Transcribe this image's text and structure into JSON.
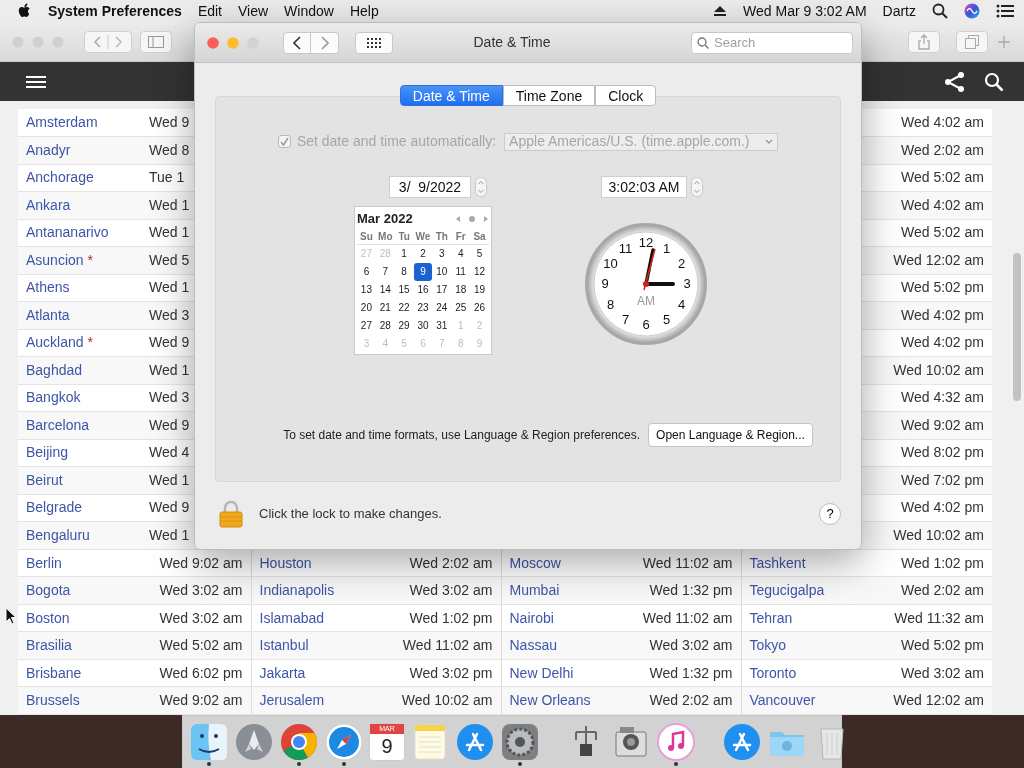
{
  "menu_bar": {
    "app_name": "System Preferences",
    "menus": [
      "Edit",
      "View",
      "Window",
      "Help"
    ],
    "clock": "Wed Mar 9  3:02 AM",
    "user": "Dartz"
  },
  "browser": {
    "table": {
      "rows": [
        {
          "city_a": "Amsterdam",
          "time_a": "Wed 9",
          "time_d": "Wed 4:02 am"
        },
        {
          "city_a": "Anadyr",
          "time_a": "Wed 8",
          "time_d": "Wed 2:02 am"
        },
        {
          "city_a": "Anchorage",
          "time_a": "Tue 1",
          "time_d": "Wed 5:02 am"
        },
        {
          "city_a": "Ankara",
          "time_a": "Wed 1",
          "time_d": "Wed 4:02 am"
        },
        {
          "city_a": "Antananarivo",
          "time_a": "Wed 1",
          "time_d": "Wed 5:02 am"
        },
        {
          "city_a": "Asuncion",
          "mark_a": "*",
          "time_a": "Wed 5",
          "time_d": "Wed 12:02 am"
        },
        {
          "city_a": "Athens",
          "time_a": "Wed 1",
          "time_d": "Wed 5:02 pm"
        },
        {
          "city_a": "Atlanta",
          "time_a": "Wed 3",
          "time_d": "Wed 4:02 pm"
        },
        {
          "city_a": "Auckland",
          "mark_a": "*",
          "time_a": "Wed 9",
          "time_d": "Wed 4:02 pm"
        },
        {
          "city_a": "Baghdad",
          "time_a": "Wed 1",
          "time_d": "Wed 10:02 am"
        },
        {
          "city_a": "Bangkok",
          "time_a": "Wed 3",
          "time_d": "Wed 4:32 am"
        },
        {
          "city_a": "Barcelona",
          "time_a": "Wed 9",
          "time_d": "Wed 9:02 am"
        },
        {
          "city_a": "Beijing",
          "time_a": "Wed 4",
          "time_d": "Wed 8:02 pm"
        },
        {
          "city_a": "Beirut",
          "time_a": "Wed 1",
          "time_d": "Wed 7:02 pm"
        },
        {
          "city_a": "Belgrade",
          "time_a": "Wed 9",
          "time_d": "Wed 4:02 pm"
        },
        {
          "city_a": "Bengaluru",
          "time_a": "Wed 1",
          "time_d": "Wed 10:02 am"
        },
        {
          "city_a": "Berlin",
          "time_a": "Wed 9:02 am",
          "city_b": "Houston",
          "time_b": "Wed 2:02 am",
          "city_c": "Moscow",
          "time_c": "Wed 11:02 am",
          "city_d": "Tashkent",
          "time_d": "Wed 1:02 pm"
        },
        {
          "city_a": "Bogota",
          "time_a": "Wed 3:02 am",
          "city_b": "Indianapolis",
          "time_b": "Wed 3:02 am",
          "city_c": "Mumbai",
          "time_c": "Wed 1:32 pm",
          "city_d": "Tegucigalpa",
          "time_d": "Wed 2:02 am"
        },
        {
          "city_a": "Boston",
          "time_a": "Wed 3:02 am",
          "city_b": "Islamabad",
          "time_b": "Wed 1:02 pm",
          "city_c": "Nairobi",
          "time_c": "Wed 11:02 am",
          "city_d": "Tehran",
          "time_d": "Wed 11:32 am"
        },
        {
          "city_a": "Brasilia",
          "time_a": "Wed 5:02 am",
          "city_b": "Istanbul",
          "time_b": "Wed 11:02 am",
          "city_c": "Nassau",
          "time_c": "Wed 3:02 am",
          "city_d": "Tokyo",
          "time_d": "Wed 5:02 pm"
        },
        {
          "city_a": "Brisbane",
          "time_a": "Wed 6:02 pm",
          "city_b": "Jakarta",
          "time_b": "Wed 3:02 pm",
          "city_c": "New Delhi",
          "time_c": "Wed 1:32 pm",
          "city_d": "Toronto",
          "time_d": "Wed 3:02 am"
        },
        {
          "city_a": "Brussels",
          "time_a": "Wed 9:02 am",
          "city_b": "Jerusalem",
          "time_b": "Wed 10:02 am",
          "city_c": "New Orleans",
          "time_c": "Wed 2:02 am",
          "city_d": "Vancouver",
          "time_d": "Wed 12:02 am"
        }
      ]
    }
  },
  "dialog": {
    "title": "Date & Time",
    "search": {
      "placeholder": "Search"
    },
    "tabs": [
      {
        "label": "Date & Time",
        "selected": true
      },
      {
        "label": "Time Zone",
        "selected": false
      },
      {
        "label": "Clock",
        "selected": false
      }
    ],
    "auto_set": {
      "label": "Set date and time automatically:",
      "checked": true,
      "disabled": true,
      "server": "Apple Americas/U.S. (time.apple.com.)"
    },
    "date_field": "3/  9/2022",
    "calendar": {
      "month": "Mar 2022",
      "weekdays": [
        "Su",
        "Mo",
        "Tu",
        "We",
        "Th",
        "Fr",
        "Sa"
      ],
      "weeks": [
        [
          {
            "day": "27",
            "other_month": true,
            "selected": false
          },
          {
            "day": "28",
            "other_month": true,
            "selected": false
          },
          {
            "day": "1",
            "other_month": false,
            "selected": false
          },
          {
            "day": "2",
            "other_month": false,
            "selected": false
          },
          {
            "day": "3",
            "other_month": false,
            "selected": false
          },
          {
            "day": "4",
            "other_month": false,
            "selected": false
          },
          {
            "day": "5",
            "other_month": false,
            "selected": false
          }
        ],
        [
          {
            "day": "6",
            "other_month": false,
            "selected": false
          },
          {
            "day": "7",
            "other_month": false,
            "selected": false
          },
          {
            "day": "8",
            "other_month": false,
            "selected": false
          },
          {
            "day": "9",
            "other_month": false,
            "selected": true
          },
          {
            "day": "10",
            "other_month": false,
            "selected": false
          },
          {
            "day": "11",
            "other_month": false,
            "selected": false
          },
          {
            "day": "12",
            "other_month": false,
            "selected": false
          }
        ],
        [
          {
            "day": "13",
            "other_month": false,
            "selected": false
          },
          {
            "day": "14",
            "other_month": false,
            "selected": false
          },
          {
            "day": "15",
            "other_month": false,
            "selected": false
          },
          {
            "day": "16",
            "other_month": false,
            "selected": false
          },
          {
            "day": "17",
            "other_month": false,
            "selected": false
          },
          {
            "day": "18",
            "other_month": false,
            "selected": false
          },
          {
            "day": "19",
            "other_month": false,
            "selected": false
          }
        ],
        [
          {
            "day": "20",
            "other_month": false,
            "selected": false
          },
          {
            "day": "21",
            "other_month": false,
            "selected": false
          },
          {
            "day": "22",
            "other_month": false,
            "selected": false
          },
          {
            "day": "23",
            "other_month": false,
            "selected": false
          },
          {
            "day": "24",
            "other_month": false,
            "selected": false
          },
          {
            "day": "25",
            "other_month": false,
            "selected": false
          },
          {
            "day": "26",
            "other_month": false,
            "selected": false
          }
        ],
        [
          {
            "day": "27",
            "other_month": false,
            "selected": false
          },
          {
            "day": "28",
            "other_month": false,
            "selected": false
          },
          {
            "day": "29",
            "other_month": false,
            "selected": false
          },
          {
            "day": "30",
            "other_month": false,
            "selected": false
          },
          {
            "day": "31",
            "other_month": false,
            "selected": false
          },
          {
            "day": "1",
            "other_month": true,
            "selected": false
          },
          {
            "day": "2",
            "other_month": true,
            "selected": false
          }
        ],
        [
          {
            "day": "3",
            "other_month": true,
            "selected": false
          },
          {
            "day": "4",
            "other_month": true,
            "selected": false
          },
          {
            "day": "5",
            "other_month": true,
            "selected": false
          },
          {
            "day": "6",
            "other_month": true,
            "selected": false
          },
          {
            "day": "7",
            "other_month": true,
            "selected": false
          },
          {
            "day": "8",
            "other_month": true,
            "selected": false
          },
          {
            "day": "9",
            "other_month": true,
            "selected": false
          }
        ]
      ]
    },
    "time_field": "3:02:03 AM",
    "clock": {
      "numerals": [
        "12",
        "11",
        "1",
        "10",
        "2",
        "9",
        "3",
        "8",
        "4",
        "7",
        "5",
        "6"
      ],
      "period": "AM"
    },
    "formats_note": "To set date and time formats, use Language & Region preferences.",
    "formats_button": "Open Language & Region...",
    "lock_note": "Click the lock to make changes.",
    "help": "?"
  },
  "dock": {
    "items": [
      {
        "kind": "finder",
        "running": true
      },
      {
        "kind": "launchpad",
        "running": false
      },
      {
        "kind": "chrome",
        "running": true
      },
      {
        "kind": "safari",
        "running": true
      },
      {
        "kind": "calendar",
        "running": false,
        "month": "MAR",
        "day": "9"
      },
      {
        "kind": "notes",
        "running": false
      },
      {
        "kind": "appstore",
        "running": false
      },
      {
        "kind": "settings",
        "running": true
      },
      {
        "kind": "separator"
      },
      {
        "kind": "utility",
        "running": false
      },
      {
        "kind": "camera",
        "running": false
      },
      {
        "kind": "music",
        "running": true
      },
      {
        "kind": "separator"
      },
      {
        "kind": "applications",
        "running": false
      },
      {
        "kind": "downloads",
        "running": false
      },
      {
        "kind": "trash",
        "running": false
      }
    ]
  }
}
